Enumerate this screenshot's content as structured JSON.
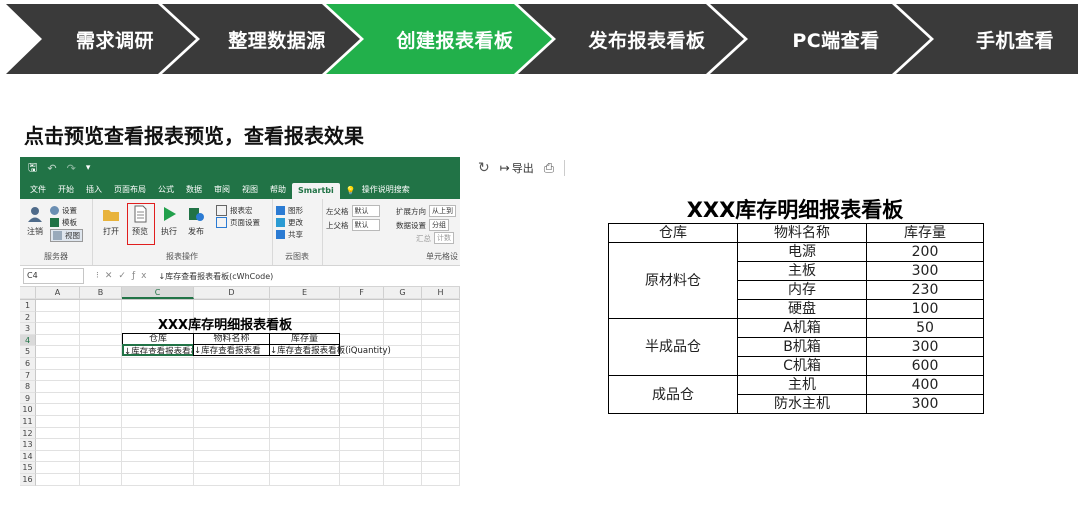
{
  "process_steps": [
    {
      "label": "需求调研",
      "active": false
    },
    {
      "label": "整理数据源",
      "active": false
    },
    {
      "label": "创建报表看板",
      "active": true
    },
    {
      "label": "发布报表看板",
      "active": false
    },
    {
      "label": "PC端查看",
      "active": false
    },
    {
      "label": "手机查看",
      "active": false
    }
  ],
  "colors": {
    "step_dark": "#3a3a3a",
    "step_active": "#22b04b",
    "excel_green": "#217346",
    "highlight_red": "#e01e1e"
  },
  "heading": "点击预览查看报表预览，查看报表效果",
  "excel": {
    "tabs": [
      "文件",
      "开始",
      "插入",
      "页面布局",
      "公式",
      "数据",
      "审阅",
      "视图",
      "帮助",
      "Smartbi",
      "操作说明搜索"
    ],
    "active_tab": "Smartbi",
    "ribbon": {
      "server_group": {
        "label": "服务器",
        "logout": "注销",
        "settings": "设置",
        "template": "模板",
        "view": "视图"
      },
      "report_group": {
        "label": "报表操作",
        "open": "打开",
        "preview": "预览",
        "execute": "执行",
        "publish": "发布",
        "report_macro": "报表宏",
        "page_setup": "页面设置"
      },
      "cloud_group": {
        "label": "云图表",
        "chart": "图形",
        "change": "更改",
        "share": "共享"
      },
      "cell_group": {
        "label": "单元格设",
        "left_parent": "左父格",
        "left_parent_val": "默认",
        "top_parent": "上父格",
        "top_parent_val": "默认",
        "expand_dir": "扩展方向",
        "expand_val": "从上到",
        "data_setting": "数据设置",
        "data_val": "分组",
        "summary": "汇总",
        "summary_val": "计数"
      }
    },
    "name_box": "C4",
    "formula": "↓库存查看报表看板(cWhCode)",
    "columns": [
      "A",
      "B",
      "C",
      "D",
      "E",
      "F",
      "G",
      "H"
    ],
    "rows": [
      "1",
      "2",
      "3",
      "4",
      "5",
      "6",
      "7",
      "8",
      "9",
      "10",
      "11",
      "12",
      "13",
      "14",
      "15",
      "16"
    ],
    "sheet_title": "XXX库存明细报表看板",
    "headers": [
      "仓库",
      "物料名称",
      "库存量"
    ],
    "bind_cells": [
      "↓库存查看报表看板",
      "↓库存查看报表看",
      "↓库存查看报表看板(iQuantity)"
    ]
  },
  "toolbar": {
    "export": "导出"
  },
  "preview": {
    "title": "XXX库存明细报表看板",
    "headers": [
      "仓库",
      "物料名称",
      "库存量"
    ],
    "groups": [
      {
        "warehouse": "原材料仓",
        "items": [
          {
            "name": "电源",
            "qty": "200"
          },
          {
            "name": "主板",
            "qty": "300"
          },
          {
            "name": "内存",
            "qty": "230"
          },
          {
            "name": "硬盘",
            "qty": "100"
          }
        ]
      },
      {
        "warehouse": "半成品仓",
        "items": [
          {
            "name": "A机箱",
            "qty": "50"
          },
          {
            "name": "B机箱",
            "qty": "300"
          },
          {
            "name": "C机箱",
            "qty": "600"
          }
        ]
      },
      {
        "warehouse": "成品仓",
        "items": [
          {
            "name": "主机",
            "qty": "400"
          },
          {
            "name": "防水主机",
            "qty": "300"
          }
        ]
      }
    ]
  }
}
